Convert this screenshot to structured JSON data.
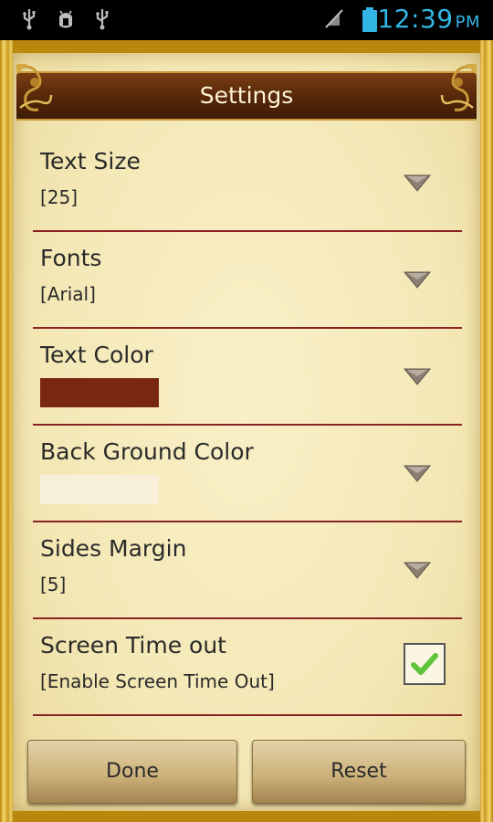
{
  "status_bar": {
    "time": "12:39",
    "ampm": "PM",
    "time_color": "#33b5e5",
    "left_icons": [
      "usb-icon",
      "android-debug-icon",
      "usb-icon"
    ],
    "right_icons": [
      "signal-muted-icon",
      "battery-icon"
    ]
  },
  "header": {
    "title": "Settings"
  },
  "settings": [
    {
      "label": "Text Size",
      "value": "[25]",
      "control": "dropdown"
    },
    {
      "label": "Fonts",
      "value": "[Arial]",
      "control": "dropdown"
    },
    {
      "label": "Text Color",
      "swatch_color": "#7a2712",
      "control": "dropdown"
    },
    {
      "label": "Back Ground Color",
      "swatch_color": "#f8efd8",
      "control": "dropdown"
    },
    {
      "label": "Sides Margin",
      "value": "[5]",
      "control": "dropdown"
    },
    {
      "label": "Screen Time out",
      "value": "[Enable Screen Time Out]",
      "control": "checkbox",
      "checked": true
    }
  ],
  "buttons": {
    "done_label": "Done",
    "reset_label": "Reset"
  }
}
